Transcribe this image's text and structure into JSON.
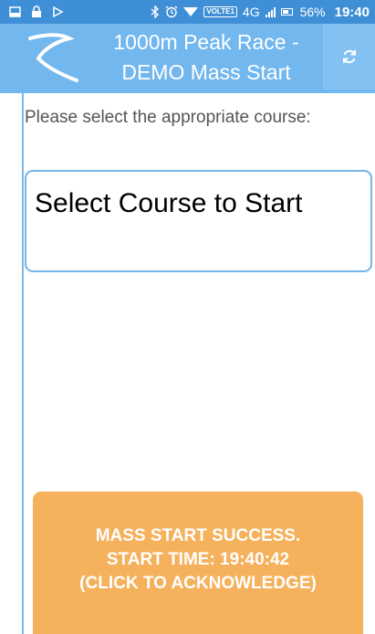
{
  "status_bar": {
    "icons": [
      "sim-icon",
      "lock-icon",
      "play-icon",
      "bluetooth-icon",
      "alarm-icon",
      "wifi-icon",
      "signal-icon",
      "battery-icon"
    ],
    "volte": "VOLTE1",
    "network": "4G",
    "battery": "56%",
    "time": "19:40"
  },
  "app_bar": {
    "title_line1": "1000m Peak Race -",
    "title_line2": "DEMO Mass Start"
  },
  "main": {
    "prompt": "Please select the appropriate course:",
    "course_select": {
      "label": "Select Course to Start"
    },
    "ack_button": {
      "line1": "MASS START SUCCESS.",
      "line2": "START TIME: 19:40:42",
      "line3": "(CLICK TO ACKNOWLEDGE)"
    }
  },
  "colors": {
    "status_bar": "#3f8fd6",
    "app_bar": "#72b7ee",
    "accent_border": "#74b5ea",
    "ack_button": "#f5b15c"
  }
}
